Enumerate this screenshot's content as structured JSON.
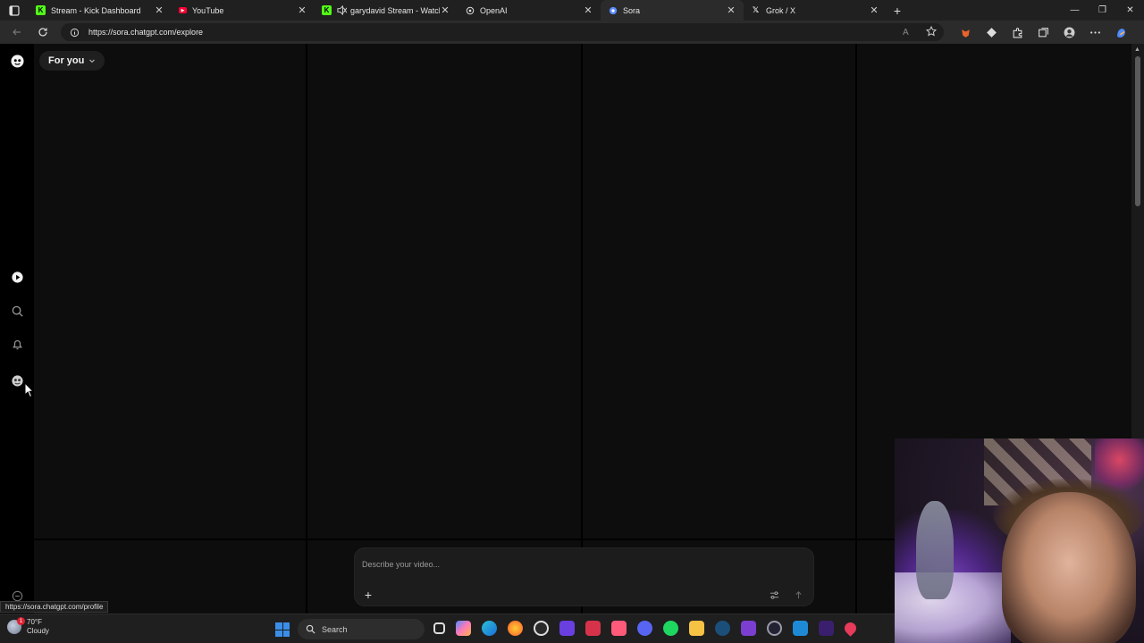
{
  "browser": {
    "tabs": [
      {
        "title": "Stream - Kick Dashboard",
        "favicon": "kick-icon",
        "active": false,
        "muted": false
      },
      {
        "title": "YouTube",
        "favicon": "youtube-icon",
        "active": false,
        "muted": false
      },
      {
        "title": "garydavid Stream - Watch Li",
        "favicon": "kick-icon",
        "active": false,
        "muted": true
      },
      {
        "title": "OpenAI",
        "favicon": "openai-icon",
        "active": false,
        "muted": false
      },
      {
        "title": "Sora",
        "favicon": "sora-icon",
        "active": true,
        "muted": false
      },
      {
        "title": "Grok / X",
        "favicon": "x-icon",
        "active": false,
        "muted": false
      }
    ],
    "url": "https://sora.chatgpt.com/explore",
    "status_url": "https://sora.chatgpt.com/profile"
  },
  "sora": {
    "feed_selector": "For you",
    "prompt_placeholder": "Describe your video...",
    "sidebar_icons": [
      "sora-logo-icon",
      "home-icon",
      "search-icon",
      "bell-icon",
      "profile-icon",
      "settings-icon"
    ]
  },
  "taskbar": {
    "temperature": "70°F",
    "weather": "Cloudy",
    "weather_badge": "1",
    "search_label": "Search"
  },
  "colors": {
    "page_bg": "#0d0d0d",
    "sidebar_bg": "#000000",
    "accent_windows": "#3a8ee8"
  }
}
